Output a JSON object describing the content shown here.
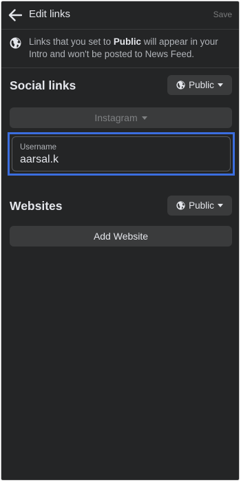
{
  "header": {
    "title": "Edit links",
    "save_label": "Save",
    "back_icon": "arrow-left-icon"
  },
  "notice": {
    "icon": "globe-icon",
    "text_before": "Links that you set to ",
    "text_bold": "Public",
    "text_after": " will appear in your Intro and won't be posted to News Feed."
  },
  "social_links": {
    "title": "Social links",
    "privacy": {
      "label": "Public",
      "icon": "globe-icon"
    },
    "platform": {
      "selected": "Instagram",
      "icon": "caret-down-icon"
    },
    "username": {
      "label": "Username",
      "value": "aarsal.k"
    }
  },
  "websites": {
    "title": "Websites",
    "privacy": {
      "label": "Public",
      "icon": "globe-icon"
    },
    "add_label": "Add Website"
  },
  "colors": {
    "background": "#242526",
    "surface": "#3a3b3c",
    "focus_outline": "#3b6ee0",
    "text_primary": "#e4e6eb",
    "text_secondary": "#b0b3b8"
  }
}
